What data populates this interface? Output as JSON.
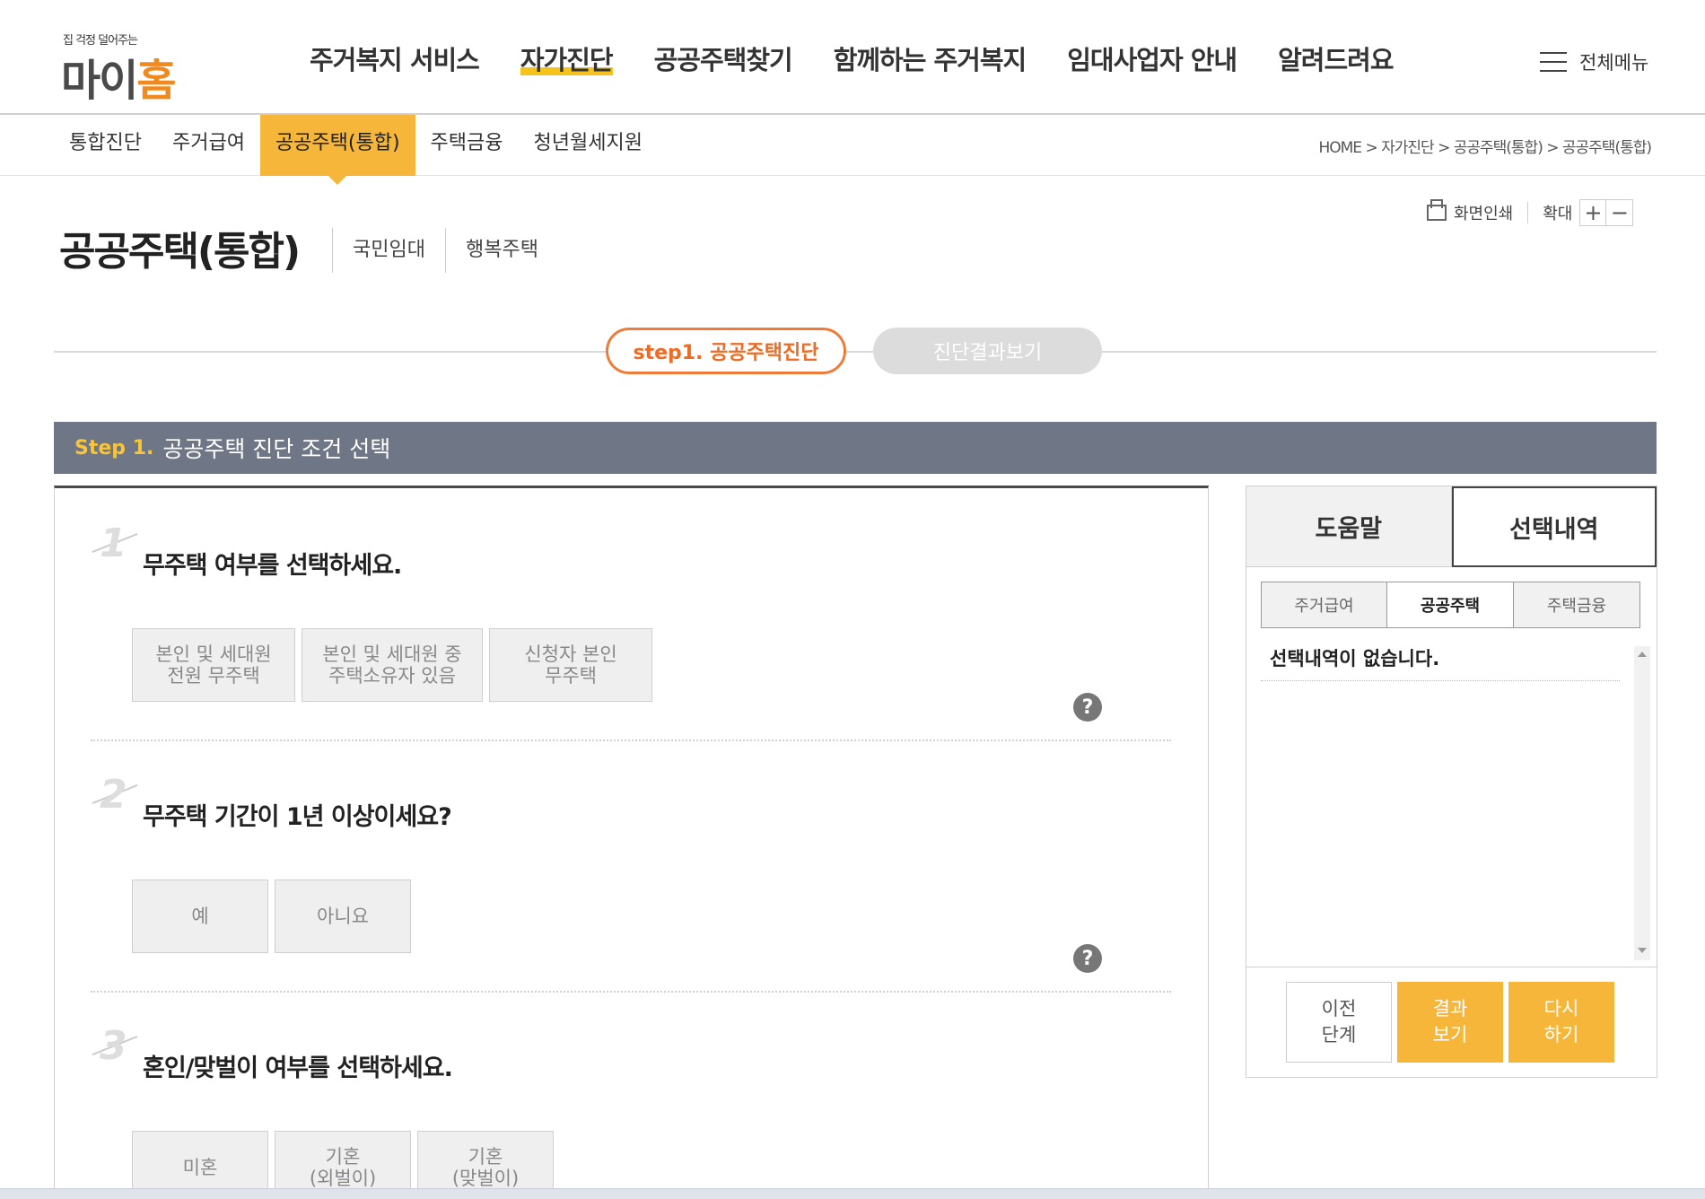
{
  "header": {
    "logo_tagline": "집 걱정 덜어주는",
    "logo_main_prefix": "마이",
    "logo_main_suffix": "홈",
    "gnb": [
      {
        "label": "주거복지 서비스"
      },
      {
        "label": "자가진단"
      },
      {
        "label": "공공주택찾기"
      },
      {
        "label": "함께하는 주거복지"
      },
      {
        "label": "임대사업자 안내"
      },
      {
        "label": "알려드려요"
      }
    ],
    "allmenu_label": "전체메뉴"
  },
  "subnav": {
    "tabs": [
      {
        "label": "통합진단"
      },
      {
        "label": "주거급여"
      },
      {
        "label": "공공주택(통합)"
      },
      {
        "label": "주택금융"
      },
      {
        "label": "청년월세지원"
      }
    ],
    "breadcrumb": [
      "HOME",
      "자가진단",
      "공공주택(통합)",
      "공공주택(통합)"
    ],
    "breadcrumb_sep": ">"
  },
  "page": {
    "title": "공공주택(통합)",
    "links": [
      "국민임대",
      "행복주택"
    ],
    "print_label": "화면인쇄",
    "zoom_label": "확대",
    "zoom_in": "+",
    "zoom_out": "−"
  },
  "steps": {
    "current": "step1. 공공주택진단",
    "next": "진단결과보기"
  },
  "step_header": {
    "num": "Step 1.",
    "title": "공공주택 진단 조건 선택"
  },
  "questions": [
    {
      "num": "1",
      "title": "무주택 여부를 선택하세요.",
      "options": [
        [
          "본인 및 세대원",
          "전원 무주택"
        ],
        [
          "본인 및 세대원 중",
          "주택소유자 있음"
        ],
        [
          "신청자 본인",
          "무주택"
        ]
      ]
    },
    {
      "num": "2",
      "title": "무주택 기간이 1년 이상이세요?",
      "options": [
        [
          "예"
        ],
        [
          "아니요"
        ]
      ]
    },
    {
      "num": "3",
      "title": "혼인/맞벌이 여부를 선택하세요.",
      "options": [
        [
          "미혼"
        ],
        [
          "기혼",
          "(외벌이)"
        ],
        [
          "기혼",
          "(맞벌이)"
        ]
      ]
    }
  ],
  "help_glyph": "?",
  "side": {
    "tabs": [
      "도움말",
      "선택내역"
    ],
    "sub_tabs": [
      "주거급여",
      "공공주택",
      "주택금융"
    ],
    "empty_text": "선택내역이 없습니다.",
    "buttons": [
      {
        "line1": "이전",
        "line2": "단계"
      },
      {
        "line1": "결과",
        "line2": "보기"
      },
      {
        "line1": "다시",
        "line2": "하기"
      }
    ]
  },
  "colors": {
    "accent_orange": "#f6b63a",
    "step_outline": "#ef7b3b",
    "step_header_bg": "#6f7685",
    "logo_orange": "#f08a1e"
  }
}
